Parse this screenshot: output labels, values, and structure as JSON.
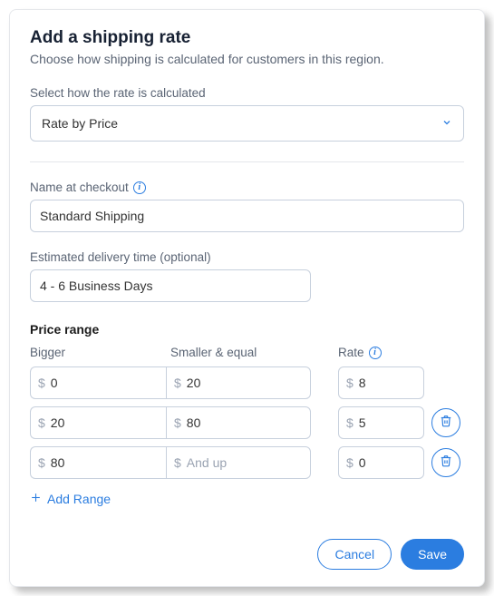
{
  "title": "Add a shipping rate",
  "subtitle": "Choose how shipping is calculated for customers in this region.",
  "calc": {
    "label": "Select how the rate is calculated",
    "value": "Rate by Price"
  },
  "name": {
    "label": "Name at checkout",
    "value": "Standard Shipping"
  },
  "eta": {
    "label": "Estimated delivery time (optional)",
    "value": "4 - 6 Business Days"
  },
  "range_header": "Price range",
  "columns": {
    "bigger": "Bigger",
    "smaller": "Smaller & equal",
    "rate": "Rate"
  },
  "currency": "$",
  "rows": [
    {
      "bigger": "0",
      "smaller": "20",
      "smaller_placeholder": "",
      "rate": "8",
      "deletable": false
    },
    {
      "bigger": "20",
      "smaller": "80",
      "smaller_placeholder": "",
      "rate": "5",
      "deletable": true
    },
    {
      "bigger": "80",
      "smaller": "",
      "smaller_placeholder": "And up",
      "rate": "0",
      "deletable": true
    }
  ],
  "add_range": "Add Range",
  "buttons": {
    "cancel": "Cancel",
    "save": "Save"
  }
}
